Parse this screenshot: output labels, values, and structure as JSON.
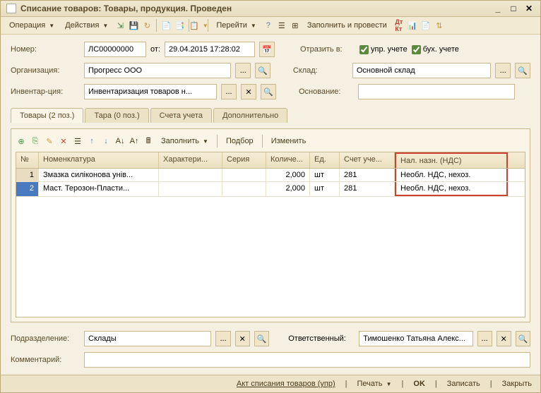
{
  "window": {
    "title": "Списание товаров: Товары, продукция. Проведен"
  },
  "main_toolbar": {
    "operation": "Операция",
    "actions": "Действия",
    "goto": "Перейти",
    "fill_post": "Заполнить и провести"
  },
  "header": {
    "number_label": "Номер:",
    "number": "ЛС00000000",
    "from_label": "от:",
    "date": "29.04.2015 17:28:02",
    "reflect_label": "Отразить в:",
    "mgmt_acc": "упр. учете",
    "acc_acc": "бух. учете",
    "org_label": "Организация:",
    "org": "Прогресс ООО",
    "warehouse_label": "Склад:",
    "warehouse": "Основной склад",
    "invent_label": "Инвентар-ция:",
    "invent": "Инвентаризация товаров н...",
    "basis_label": "Основание:",
    "basis": ""
  },
  "tabs": {
    "goods": "Товары (2 поз.)",
    "tare": "Тара (0 поз.)",
    "accounts": "Счета учета",
    "extra": "Дополнительно"
  },
  "subtoolbar": {
    "fill": "Заполнить",
    "select": "Подбор",
    "edit": "Изменить"
  },
  "columns": {
    "num": "№",
    "nom": "Номенклатура",
    "char": "Характери...",
    "ser": "Серия",
    "qty": "Количе...",
    "unit": "Ед.",
    "acc": "Счет уче...",
    "vat": "Нал. назн. (НДС)"
  },
  "rows": [
    {
      "num": "1",
      "nom": "Змазка силіконова унів...",
      "char": "",
      "ser": "",
      "qty": "2,000",
      "unit": "шт",
      "acc": "281",
      "vat": "Необл. НДС, нехоз."
    },
    {
      "num": "2",
      "nom": "Маст. Терозон-Пласти...",
      "char": "",
      "ser": "",
      "qty": "2,000",
      "unit": "шт",
      "acc": "281",
      "vat": "Необл. НДС, нехоз."
    }
  ],
  "footer_fields": {
    "dept_label": "Подразделение:",
    "dept": "Склады",
    "resp_label": "Ответственный:",
    "resp": "Тимошенко Татьяна Алекс...",
    "comment_label": "Комментарий:",
    "comment": ""
  },
  "footer": {
    "act": "Акт списания товаров (упр)",
    "print": "Печать",
    "ok": "OK",
    "save": "Записать",
    "close": "Закрыть"
  }
}
